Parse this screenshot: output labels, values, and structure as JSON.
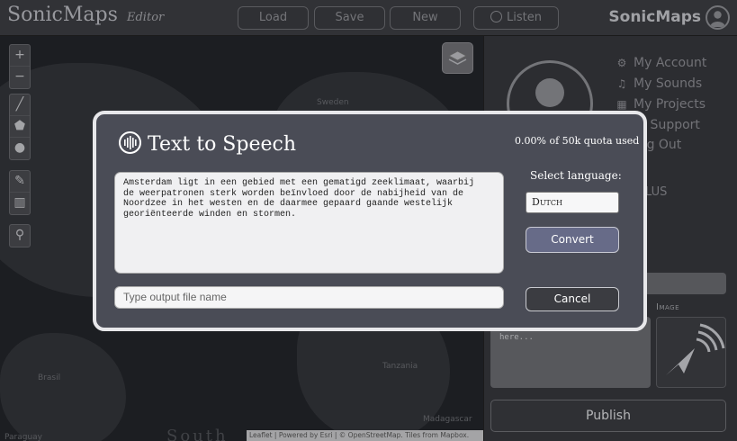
{
  "header": {
    "brand": "SonicMaps",
    "brand_sub": "Editor",
    "buttons": {
      "load": "Load",
      "save": "Save",
      "new": "New",
      "listen": "Listen"
    },
    "brand_right": "SonicMaps"
  },
  "map": {
    "labels": {
      "sweden": "Sweden",
      "brasil": "Brasil",
      "tanzania": "Tanzania",
      "madagascar": "Madagascar",
      "paraguay": "Paraguay",
      "south": "South"
    },
    "attribution": "Leaflet | Powered by Esri | © OpenStreetMap. Tiles from Mapbox."
  },
  "panel": {
    "menu": {
      "account": "My Account",
      "sounds": "My Sounds",
      "projects": "My Projects",
      "support": "et Support",
      "logout": "og Out"
    },
    "plus_fragment": "LUS",
    "image_label": "Image",
    "desc_text": "here...",
    "publish": "Publish"
  },
  "modal": {
    "title": "Text to Speech",
    "quota": "0.00% of 50k quota used",
    "text": "Amsterdam ligt in een gebied met een gematigd zeeklimaat, waarbij\nde weerpatronen sterk worden beïnvloed door de nabijheid van de\nNoordzee in het westen en de daarmee gepaard gaande westelijk\ngeoriënteerde winden en stormen.",
    "select_language_label": "Select language:",
    "language": "Dutch",
    "convert": "Convert",
    "filename_placeholder": "Type output file name",
    "cancel": "Cancel"
  },
  "colors": {
    "modal_bg": "#4a4c56",
    "modal_border": "#e7e7ea",
    "convert_bg": "#676b88",
    "header_bg": "#3c3d42"
  }
}
